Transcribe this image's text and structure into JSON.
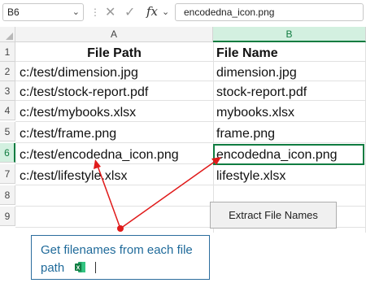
{
  "formula_bar": {
    "name_box": "B6",
    "formula": "encodedna_icon.png",
    "cancel_icon": "✕",
    "enter_icon": "✓",
    "fx_label": "fx"
  },
  "columns": [
    "A",
    "B"
  ],
  "rows": [
    "1",
    "2",
    "3",
    "4",
    "5",
    "6",
    "7",
    "8",
    "9"
  ],
  "cells": {
    "headers": [
      "File Path",
      "File Name"
    ],
    "data": [
      [
        "c:/test/dimension.jpg",
        "dimension.jpg"
      ],
      [
        "c:/test/stock-report.pdf",
        "stock-report.pdf"
      ],
      [
        "c:/test/mybooks.xlsx",
        "mybooks.xlsx"
      ],
      [
        "c:/test/frame.png",
        "frame.png"
      ],
      [
        "c:/test/encodedna_icon.png",
        "encodedna_icon.png"
      ],
      [
        "c:/test/lifestyle.xlsx",
        "lifestyle.xlsx"
      ]
    ]
  },
  "selected": {
    "cell": "B6",
    "column": "B",
    "row": "6"
  },
  "button": {
    "label": "Extract File Names"
  },
  "callout": {
    "text": "Get filenames from each file path"
  },
  "colors": {
    "accent": "#107c41",
    "callout": "#2c6d9e",
    "arrow": "#e01a1a"
  }
}
